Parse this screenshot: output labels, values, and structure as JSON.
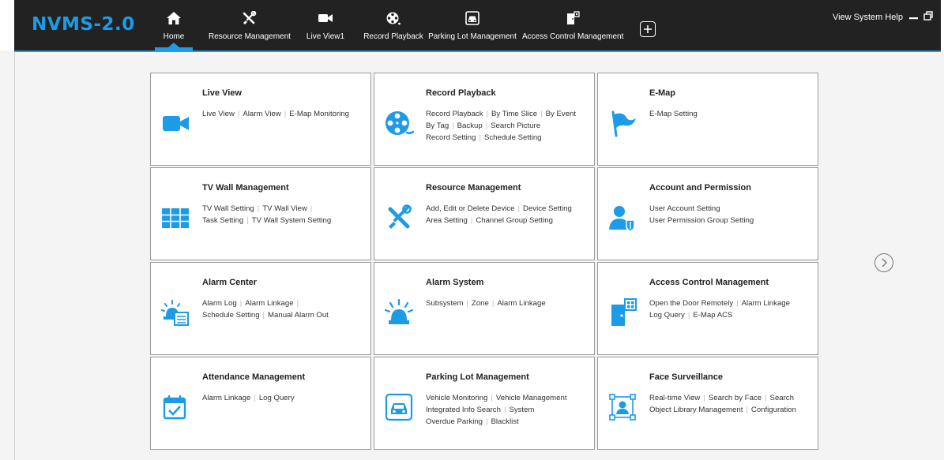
{
  "app": {
    "title": "NVMS-2.0"
  },
  "colors": {
    "accent": "#1e9be6",
    "topbar": "#222222",
    "background": "#f4f4f4"
  },
  "tabs": [
    {
      "label": "Home",
      "icon": "home-icon",
      "active": true
    },
    {
      "label": "Resource Management",
      "icon": "tools-icon"
    },
    {
      "label": "Live View1",
      "icon": "video-camera-icon"
    },
    {
      "label": "Record Playback",
      "icon": "film-reel-icon"
    },
    {
      "label": "Parking Lot Management",
      "icon": "parking-icon"
    },
    {
      "label": "Access Control Management",
      "icon": "door-access-icon"
    }
  ],
  "add_tab": {
    "icon": "plus-icon"
  },
  "window": {
    "help": "View System Help",
    "minimize_icon": "minimize-icon",
    "restore_icon": "restore-icon"
  },
  "modules": [
    {
      "title": "Live View",
      "icon": "video-camera-icon",
      "lines": [
        [
          "Live View",
          "Alarm View",
          "E-Map Monitoring"
        ]
      ]
    },
    {
      "title": "Record Playback",
      "icon": "film-reel-icon",
      "lines": [
        [
          "Record Playback",
          "By Time Slice",
          "By Event"
        ],
        [
          "By Tag",
          "Backup",
          "Search Picture"
        ],
        [
          "Record Setting",
          "Schedule Setting"
        ]
      ]
    },
    {
      "title": "E-Map",
      "icon": "flag-icon",
      "lines": [
        [
          "E-Map Setting"
        ]
      ]
    },
    {
      "title": "TV Wall Management",
      "icon": "tv-wall-icon",
      "lines": [
        [
          "TV Wall Setting",
          "TV Wall View",
          ""
        ],
        [
          "Task Setting",
          "TV Wall System Setting"
        ]
      ]
    },
    {
      "title": "Resource Management",
      "icon": "tools-icon",
      "lines": [
        [
          "Add, Edit or Delete Device",
          "Device Setting"
        ],
        [
          "Area Setting",
          "Channel Group Setting"
        ]
      ]
    },
    {
      "title": "Account and Permission",
      "icon": "user-shield-icon",
      "lines": [
        [
          "User Account Setting"
        ],
        [
          "User Permission Group Setting"
        ]
      ]
    },
    {
      "title": "Alarm Center",
      "icon": "alarm-center-icon",
      "lines": [
        [
          "Alarm Log",
          "Alarm Linkage",
          ""
        ],
        [
          "Schedule Setting",
          "Manual Alarm Out"
        ]
      ]
    },
    {
      "title": "Alarm System",
      "icon": "alarm-light-icon",
      "lines": [
        [
          "Subsystem",
          "Zone",
          "Alarm Linkage"
        ]
      ]
    },
    {
      "title": "Access Control Management",
      "icon": "door-access-icon",
      "lines": [
        [
          "Open the Door Remotely",
          "Alarm Linkage"
        ],
        [
          "Log Query",
          "E-Map ACS"
        ]
      ]
    },
    {
      "title": "Attendance Management",
      "icon": "calendar-check-icon",
      "lines": [
        [
          "Alarm Linkage",
          "Log Query"
        ]
      ]
    },
    {
      "title": "Parking Lot Management",
      "icon": "parking-icon",
      "lines": [
        [
          "Vehicle Monitoring",
          "Vehicle Management"
        ],
        [
          "Integrated Info Search",
          "System"
        ],
        [
          "Overdue Parking",
          "Blacklist"
        ]
      ]
    },
    {
      "title": "Face Surveillance",
      "icon": "face-scan-icon",
      "lines": [
        [
          "Real-time View",
          "Search by Face",
          "Search"
        ],
        [
          "Object Library Management",
          "Configuration"
        ]
      ]
    }
  ],
  "pager": {
    "icon": "chevron-right-circle-icon"
  }
}
